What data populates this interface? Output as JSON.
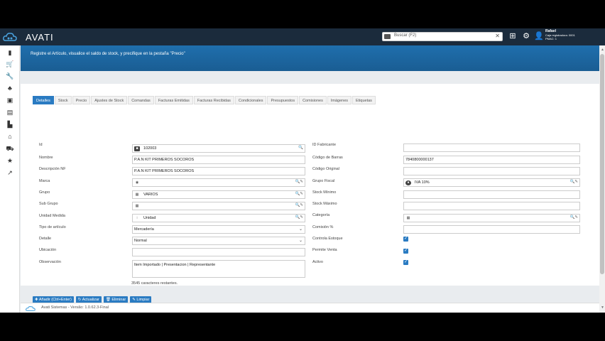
{
  "app": {
    "brand": "AVATI"
  },
  "search": {
    "placeholder": "Buscar (F2)"
  },
  "user": {
    "name": "Rafael",
    "line1": "Caja registradora: 0001",
    "line2": "PMAC: 1"
  },
  "banner": {
    "text": "Registre el Artículo, visualice el saldo de stock, y precifique en la pestaña \"Precio\""
  },
  "sidebar": {
    "icons": [
      "book-icon",
      "cart-icon",
      "wrench-icon",
      "group-icon",
      "money-icon",
      "cash-register-icon",
      "factory-icon",
      "bank-icon",
      "truck-icon",
      "star-icon",
      "chart-icon"
    ]
  },
  "tabs": [
    "Detalles",
    "Stock",
    "Precio",
    "Ajustes de Stock",
    "Comandas",
    "Facturas Emitidas",
    "Facturas Recibidas",
    "Condicionales",
    "Presupuestos",
    "Comisiones",
    "Imágenes",
    "Etiquetas"
  ],
  "form": {
    "id": {
      "label": "Id",
      "value": "102003"
    },
    "nombre": {
      "label": "Nombre",
      "value": "P.A.N KIT PRIMEROS SOCOROS"
    },
    "descripcion": {
      "label": "Descripción NF",
      "value": "P.A.N KIT PRIMEROS SOCOROS"
    },
    "marca": {
      "label": "Marca",
      "value": ""
    },
    "grupo": {
      "label": "Grupo",
      "value": "VARIOS"
    },
    "subgrupo": {
      "label": "Sub Grupo",
      "value": ""
    },
    "unidad": {
      "label": "Unidad Medida",
      "value": "Unidad"
    },
    "tipo": {
      "label": "Tipo de artículo",
      "value": "Mercadería"
    },
    "detalle": {
      "label": "Detalle",
      "value": "Normal"
    },
    "ubicacion": {
      "label": "Ubicación",
      "value": ""
    },
    "observacion": {
      "label": "Observación",
      "value": "Item Importado    | Presentacion    | Representante"
    },
    "counter": "3545 caracteres restantes.",
    "fabricante": {
      "label": "ID Fabricante",
      "value": ""
    },
    "barras": {
      "label": "Código de Barras",
      "value": "7840800000137"
    },
    "original": {
      "label": "Código Original",
      "value": ""
    },
    "fiscal": {
      "label": "Grupo Fiscal",
      "value": "IVA 10%"
    },
    "stockmin": {
      "label": "Stock Mínimo",
      "value": ""
    },
    "stockmax": {
      "label": "Stock Máximo",
      "value": ""
    },
    "categoria": {
      "label": "Categoría",
      "value": ""
    },
    "comision": {
      "label": "Comisión %",
      "value": ""
    },
    "controla": {
      "label": "Controla Estoque",
      "checked": true
    },
    "permite": {
      "label": "Permite Venta",
      "checked": true
    },
    "activo": {
      "label": "Activo",
      "checked": true
    }
  },
  "buttons": {
    "add": "Añadir (Ctrl+Enter)",
    "refresh": "Actualizar",
    "delete": "Eliminar",
    "clear": "Limpiar"
  },
  "footer": {
    "text": "Avati Sistemas - Versão: 1.0.62.3-Final"
  }
}
